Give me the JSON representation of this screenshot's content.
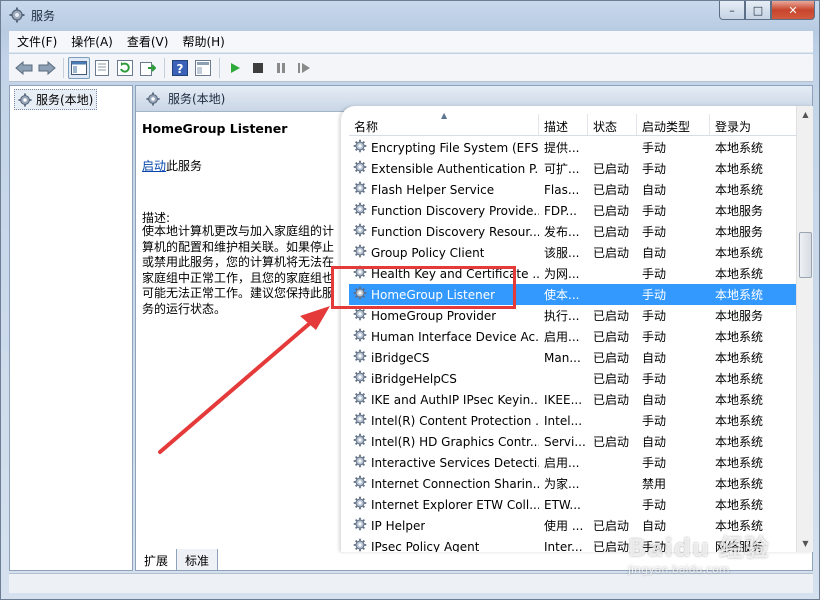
{
  "window": {
    "title": "服务",
    "minimize": "–",
    "maximize": "□",
    "close": "✕"
  },
  "menu": [
    "文件(F)",
    "操作(A)",
    "查看(V)",
    "帮助(H)"
  ],
  "toolbar_icons": [
    "back-arrow-icon",
    "forward-arrow-icon",
    "console-tree-icon",
    "properties-icon",
    "refresh-icon",
    "export-icon",
    "help-icon",
    "view-icon",
    "start-icon",
    "stop-icon",
    "pause-icon",
    "restart-icon"
  ],
  "tree": {
    "root_label": "服务(本地)"
  },
  "pane": {
    "header": "服务(本地)",
    "selected_title": "HomeGroup Listener",
    "start_link": "启动",
    "start_suffix": "此服务",
    "desc_label": "描述:",
    "desc_text": "使本地计算机更改与加入家庭组的计算机的配置和维护相关联。如果停止或禁用此服务，您的计算机将无法在家庭组中正常工作，且您的家庭组也可能无法正常工作。建议您保持此服务的运行状态。"
  },
  "columns": {
    "name": "名称",
    "desc": "描述",
    "state": "状态",
    "start_type": "启动类型",
    "logon": "登录为"
  },
  "services": [
    {
      "name": "Encrypting File System (EFS)",
      "desc": "提供...",
      "state": "",
      "start": "手动",
      "logon": "本地系统"
    },
    {
      "name": "Extensible Authentication P...",
      "desc": "可扩...",
      "state": "已启动",
      "start": "手动",
      "logon": "本地系统"
    },
    {
      "name": "Flash Helper Service",
      "desc": "Flas...",
      "state": "已启动",
      "start": "自动",
      "logon": "本地系统"
    },
    {
      "name": "Function Discovery Provide...",
      "desc": "FDP...",
      "state": "已启动",
      "start": "手动",
      "logon": "本地服务"
    },
    {
      "name": "Function Discovery Resour...",
      "desc": "发布...",
      "state": "已启动",
      "start": "手动",
      "logon": "本地服务"
    },
    {
      "name": "Group Policy Client",
      "desc": "该服...",
      "state": "已启动",
      "start": "自动",
      "logon": "本地系统"
    },
    {
      "name": "Health Key and Certificate ...",
      "desc": "为网...",
      "state": "",
      "start": "手动",
      "logon": "本地系统"
    },
    {
      "name": "HomeGroup Listener",
      "desc": "使本...",
      "state": "",
      "start": "手动",
      "logon": "本地系统",
      "selected": true
    },
    {
      "name": "HomeGroup Provider",
      "desc": "执行...",
      "state": "已启动",
      "start": "手动",
      "logon": "本地服务"
    },
    {
      "name": "Human Interface Device Ac...",
      "desc": "启用...",
      "state": "已启动",
      "start": "手动",
      "logon": "本地系统"
    },
    {
      "name": "iBridgeCS",
      "desc": "Man...",
      "state": "已启动",
      "start": "自动",
      "logon": "本地系统"
    },
    {
      "name": "iBridgeHelpCS",
      "desc": "",
      "state": "已启动",
      "start": "手动",
      "logon": "本地系统"
    },
    {
      "name": "IKE and AuthIP IPsec Keyin...",
      "desc": "IKEE...",
      "state": "已启动",
      "start": "自动",
      "logon": "本地系统"
    },
    {
      "name": "Intel(R) Content Protection ...",
      "desc": "Intel...",
      "state": "",
      "start": "手动",
      "logon": "本地系统"
    },
    {
      "name": "Intel(R) HD Graphics Contr...",
      "desc": "Servi...",
      "state": "已启动",
      "start": "自动",
      "logon": "本地系统"
    },
    {
      "name": "Interactive Services Detecti...",
      "desc": "启用...",
      "state": "",
      "start": "手动",
      "logon": "本地系统"
    },
    {
      "name": "Internet Connection Sharin...",
      "desc": "为家...",
      "state": "",
      "start": "禁用",
      "logon": "本地系统"
    },
    {
      "name": "Internet Explorer ETW Coll...",
      "desc": "ETW...",
      "state": "",
      "start": "手动",
      "logon": "本地系统"
    },
    {
      "name": "IP Helper",
      "desc": "使用 ...",
      "state": "已启动",
      "start": "自动",
      "logon": "本地系统"
    },
    {
      "name": "IPsec Policy Agent",
      "desc": "Inter...",
      "state": "已启动",
      "start": "手动",
      "logon": "网络服务"
    }
  ],
  "tabs": [
    "扩展",
    "标准"
  ],
  "watermark": {
    "logo": "Baidu 经验",
    "url": "jingyan.baidu.com"
  },
  "colors": {
    "selection": "#3399ff",
    "annotation": "#e53a3a"
  }
}
